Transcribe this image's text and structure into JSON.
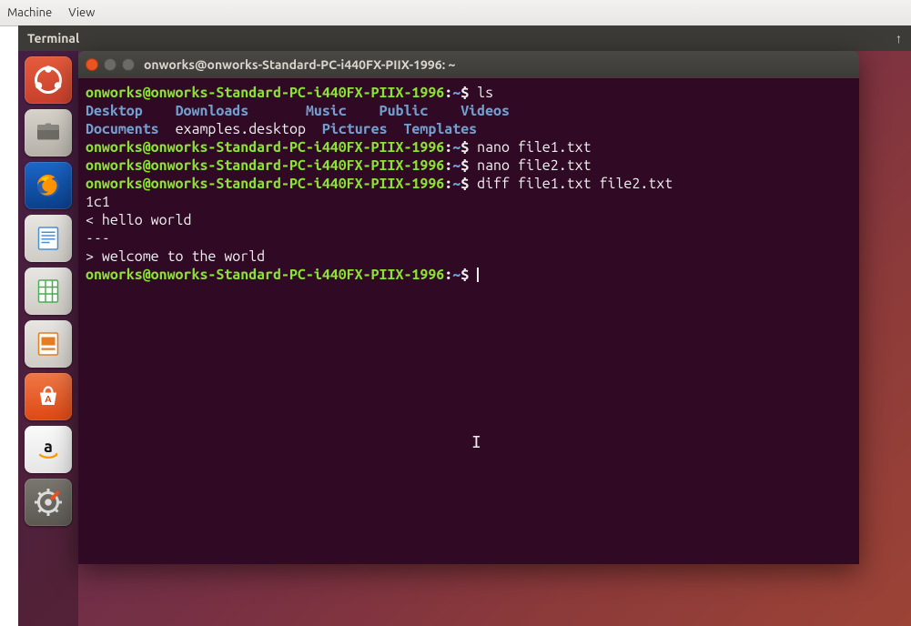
{
  "vm_menu": {
    "machine": "Machine",
    "view": "View"
  },
  "topbar": {
    "title": "Terminal",
    "indicator": "↑"
  },
  "launcher_icons": [
    "ubuntu-dash-icon",
    "files-icon",
    "firefox-icon",
    "writer-icon",
    "calc-icon",
    "impress-icon",
    "software-center-icon",
    "amazon-icon",
    "settings-icon"
  ],
  "window": {
    "buttons": {
      "close": "#e95420",
      "min": "#8b8b8b",
      "max": "#8b8b8b"
    },
    "title": "onworks@onworks-Standard-PC-i440FX-PIIX-1996: ~"
  },
  "prompt": {
    "user_host": "onworks@onworks-Standard-PC-i440FX-PIIX-1996",
    "sep": ":",
    "path": "~",
    "sym": "$"
  },
  "cmds": {
    "ls": "ls",
    "nano1": "nano file1.txt",
    "nano2": "nano file2.txt",
    "diff": "diff file1.txt file2.txt"
  },
  "ls_out": {
    "col1a": "Desktop",
    "col1b": "Documents",
    "col2a": "Downloads",
    "col2b": "examples.desktop",
    "col3a": "Music",
    "col3b": "Pictures",
    "col4a": "Public",
    "col4b": "Templates",
    "col5a": "Videos"
  },
  "diff_out": {
    "l1": "1c1",
    "l2": "< hello world",
    "l3": "---",
    "l4": "> welcome to the world"
  },
  "pad": {
    "a": "    ",
    "b": "  ",
    "c": "       ",
    "d": "    ",
    "e": "    ",
    "f": "  ",
    "g": "  ",
    "h": "  "
  }
}
